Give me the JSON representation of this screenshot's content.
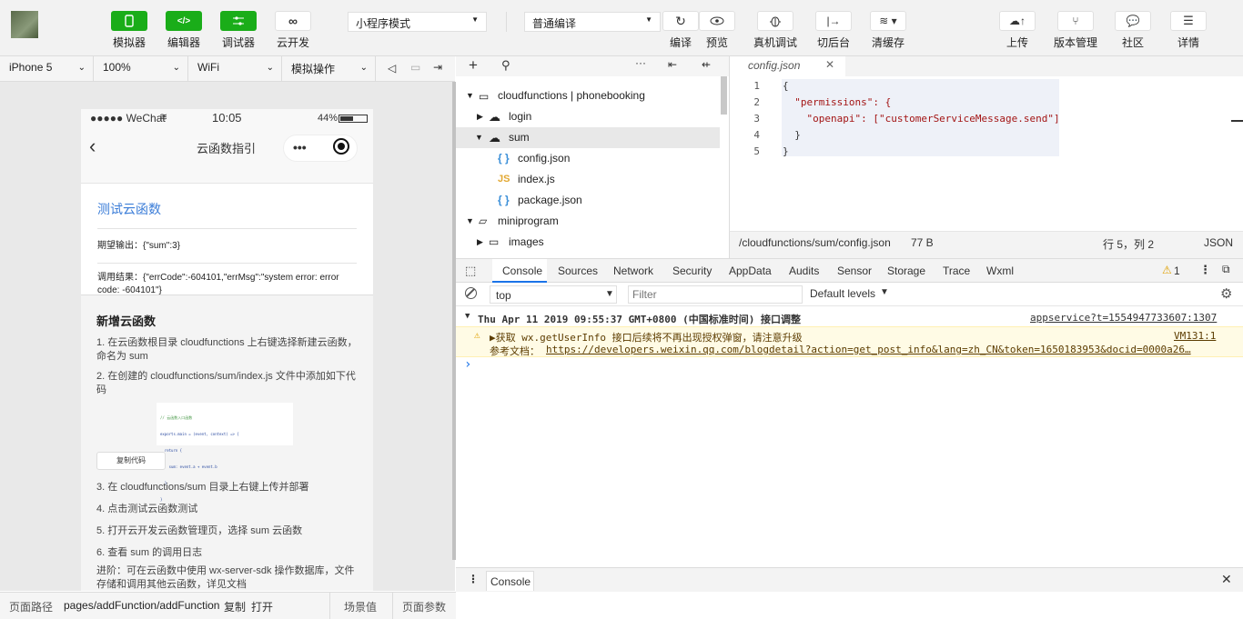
{
  "toolbar": {
    "left_buttons": [
      {
        "label": "模拟器",
        "icon": "phone-icon"
      },
      {
        "label": "编辑器",
        "icon": "code-icon"
      },
      {
        "label": "调试器",
        "icon": "sliders-icon"
      },
      {
        "label": "云开发",
        "icon": "cloud-dev-icon"
      }
    ],
    "mode_select": "小程序模式",
    "compile_select": "普通编译",
    "mid_buttons": [
      {
        "label": "编译",
        "icon": "refresh-icon"
      },
      {
        "label": "预览",
        "icon": "eye-icon"
      },
      {
        "label": "真机调试",
        "icon": "bug-icon"
      },
      {
        "label": "切后台",
        "icon": "switch-icon"
      },
      {
        "label": "清缓存",
        "icon": "layers-icon"
      }
    ],
    "right_buttons": [
      {
        "label": "上传",
        "icon": "upload-icon"
      },
      {
        "label": "版本管理",
        "icon": "branch-icon"
      },
      {
        "label": "社区",
        "icon": "chat-icon"
      },
      {
        "label": "详情",
        "icon": "menu-icon"
      }
    ]
  },
  "device_bar": {
    "device": "iPhone 5",
    "zoom": "100%",
    "network": "WiFi",
    "operation": "模拟操作"
  },
  "phone": {
    "carrier": "●●●●● WeChat",
    "time": "10:05",
    "battery": "44%",
    "nav_title": "云函数指引",
    "test_link": "测试云函数",
    "expected": "期望输出：{\"sum\":3}",
    "result": "调用结果：{\"errCode\":-604101,\"errMsg\":\"system error: error code: -604101\"}",
    "section_title": "新增云函数",
    "steps": [
      "1. 在云函数根目录 cloudfunctions 上右键选择新建云函数，命名为 sum",
      "2. 在创建的 cloudfunctions/sum/index.js 文件中添加如下代码",
      "3. 在 cloudfunctions/sum 目录上右键上传并部署",
      "4. 点击测试云函数测试",
      "5. 打开云开发云函数管理页，选择 sum 云函数",
      "6. 查看 sum 的调用日志",
      "进阶：可在云函数中使用 wx-server-sdk 操作数据库，文件存储和调用其他云函数，详见文档"
    ],
    "snippet_lines": [
      "// 云函数入口函数",
      "exports.main = (event, context) => {",
      "  return {",
      "    sum: event.a + event.b",
      "  }",
      "}"
    ],
    "copy_button": "复制代码"
  },
  "file_tree": {
    "items": [
      {
        "label": "cloudfunctions | phonebooking",
        "indent": 0,
        "arrow": "▼",
        "kind": "folder-cloud"
      },
      {
        "label": "login",
        "indent": 1,
        "arrow": "▶",
        "kind": "cloud"
      },
      {
        "label": "sum",
        "indent": 1,
        "arrow": "▼",
        "kind": "cloud"
      },
      {
        "label": "config.json",
        "indent": 2,
        "arrow": "",
        "kind": "json"
      },
      {
        "label": "index.js",
        "indent": 2,
        "arrow": "",
        "kind": "js"
      },
      {
        "label": "package.json",
        "indent": 2,
        "arrow": "",
        "kind": "json"
      },
      {
        "label": "miniprogram",
        "indent": 0,
        "arrow": "▼",
        "kind": "folder"
      },
      {
        "label": "images",
        "indent": 1,
        "arrow": "▶",
        "kind": "folder"
      }
    ]
  },
  "editor": {
    "tab": "config.json",
    "lines": [
      {
        "n": "1",
        "text": "{"
      },
      {
        "n": "2",
        "text": "  \"permissions\": {"
      },
      {
        "n": "3",
        "text": "    \"openapi\": [\"customerServiceMessage.send\"]"
      },
      {
        "n": "4",
        "text": "  }"
      },
      {
        "n": "5",
        "text": "}"
      }
    ],
    "status_path": "/cloudfunctions/sum/config.json",
    "status_size": "77 B",
    "status_pos": "行 5，列 2",
    "status_lang": "JSON"
  },
  "devtools": {
    "tabs": [
      "Console",
      "Sources",
      "Network",
      "Security",
      "AppData",
      "Audits",
      "Sensor",
      "Storage",
      "Trace",
      "Wxml"
    ],
    "warn_count": "1",
    "context": "top",
    "filter_placeholder": "Filter",
    "levels": "Default levels",
    "log_group": "Thu Apr 11 2019 09:55:37 GMT+0800 (中国标准时间) 接口调整",
    "log_source": "appservice?t=1554947733607:1307",
    "warn_line1": "▶获取 wx.getUserInfo 接口后续将不再出现授权弹窗，请注意升级",
    "warn_source": "VM131:1",
    "warn_line2_label": "参考文档：",
    "warn_link": "https://developers.weixin.qq.com/blogdetail?action=get_post_info&lang=zh_CN&token=1650183953&docid=0000a26…",
    "prompt": "›",
    "drawer_tab": "Console"
  },
  "bottom": {
    "label": "页面路径",
    "path": "pages/addFunction/addFunction",
    "copy": "复制",
    "open": "打开",
    "scene": "场景值",
    "params": "页面参数"
  },
  "colors": {
    "green": "#1aad19",
    "link": "#3b7dd8",
    "warn_bg": "#fffbe5"
  }
}
